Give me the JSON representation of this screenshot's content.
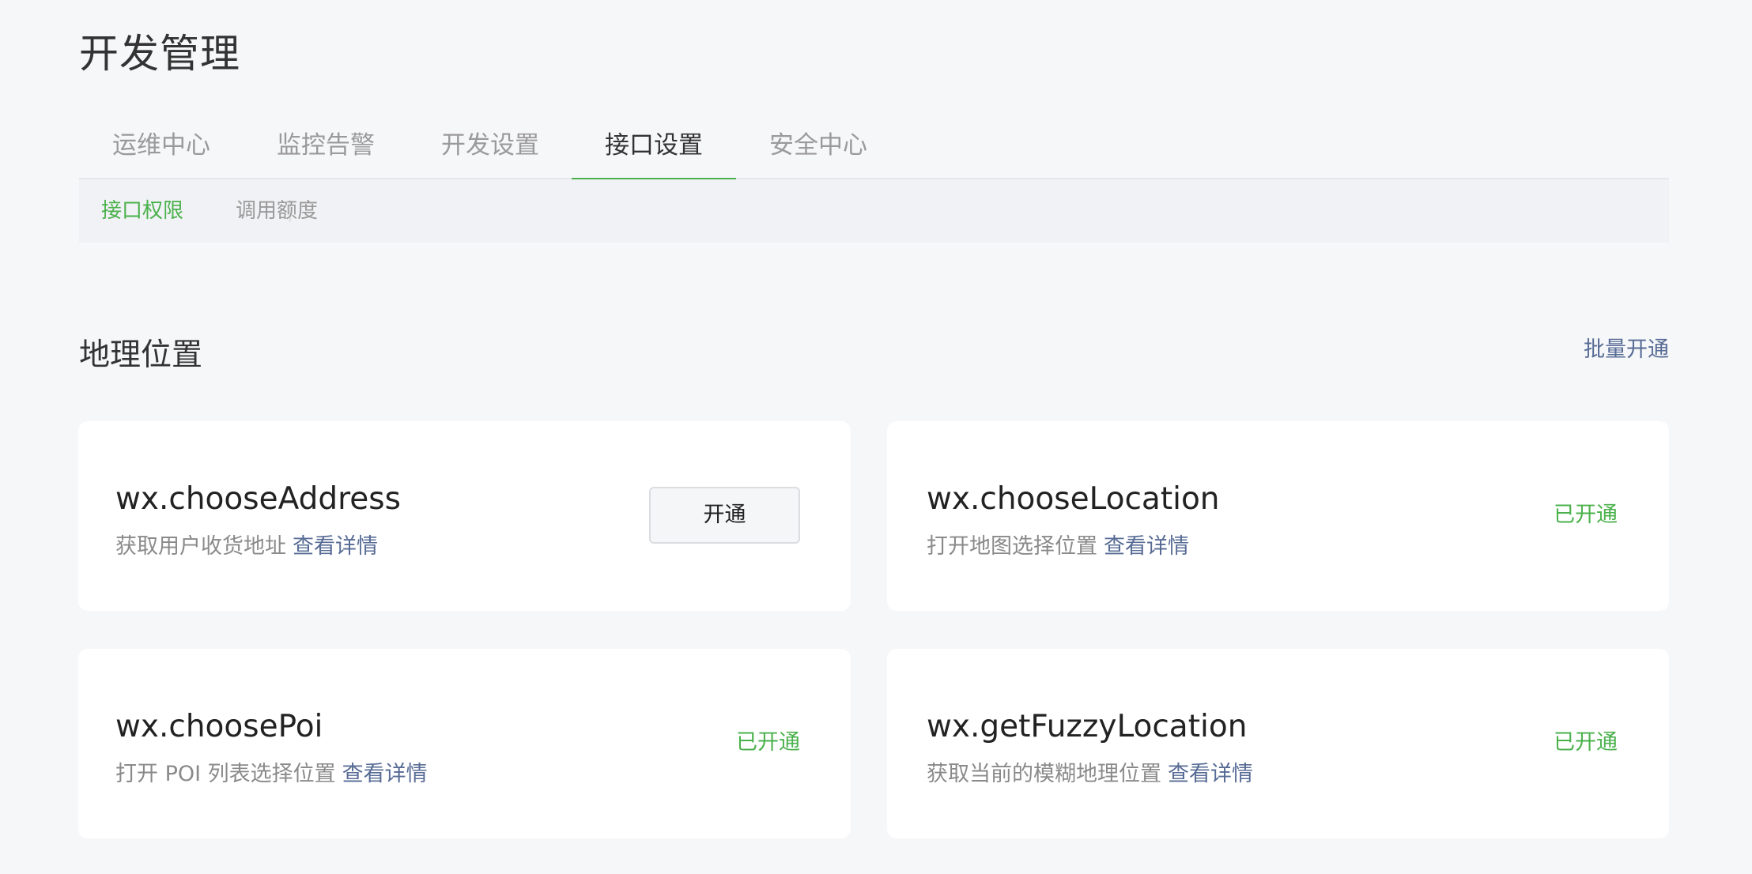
{
  "header": {
    "title": "开发管理"
  },
  "tabs": [
    {
      "label": "运维中心"
    },
    {
      "label": "监控告警"
    },
    {
      "label": "开发设置"
    },
    {
      "label": "接口设置",
      "active": true
    },
    {
      "label": "安全中心"
    }
  ],
  "subnav": {
    "items": [
      {
        "label": "接口权限",
        "active": true
      },
      {
        "label": "调用额度"
      }
    ]
  },
  "section": {
    "title": "地理位置",
    "batch_label": "批量开通"
  },
  "cards": [
    {
      "name": "wx.chooseAddress",
      "description": "获取用户收货地址",
      "detail_label": "查看详情",
      "action_label": "开通"
    },
    {
      "name": "wx.chooseLocation",
      "description": "打开地图选择位置",
      "detail_label": "查看详情",
      "status_label": "已开通"
    },
    {
      "name": "wx.choosePoi",
      "description": "打开 POI 列表选择位置",
      "detail_label": "查看详情",
      "status_label": "已开通"
    },
    {
      "name": "wx.getFuzzyLocation",
      "description": "获取当前的模糊地理位置",
      "detail_label": "查看详情",
      "status_label": "已开通"
    }
  ],
  "colors": {
    "accent_green": "#4bb14c",
    "link_blue": "#576b95",
    "background": "#f6f7f9"
  }
}
